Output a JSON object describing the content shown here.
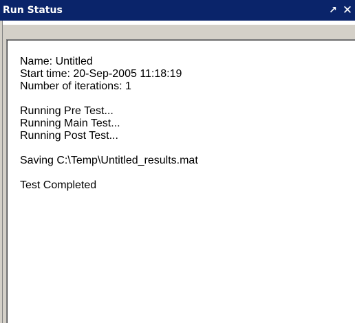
{
  "window": {
    "title": "Run Status",
    "undock_glyph": "↗",
    "close_glyph": "✕"
  },
  "status": {
    "name_line": "Name: Untitled",
    "start_time_line": "Start time: 20-Sep-2005 11:18:19",
    "iterations_line": "Number of iterations: 1",
    "pre_test_line": "Running Pre Test...",
    "main_test_line": "Running Main Test...",
    "post_test_line": "Running Post Test...",
    "saving_line": "Saving C:\\Temp\\Untitled_results.mat",
    "completed_line": "Test Completed"
  },
  "icons": {
    "undock": "undock-arrow-icon",
    "close": "close-icon"
  },
  "colors": {
    "title_bar": "#0a246a",
    "toolbar": "#d4d0c8",
    "text": "#000000"
  }
}
